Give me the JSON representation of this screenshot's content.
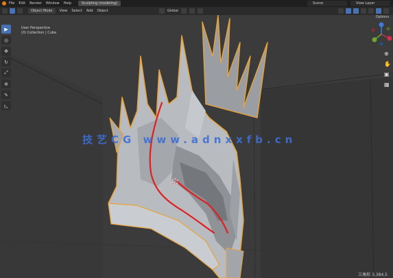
{
  "topbar": {
    "menu": [
      "File",
      "Edit",
      "Render",
      "Window",
      "Help"
    ],
    "workspace_tab": "Sculpting (modeling)",
    "scene_field": "Scene",
    "view_layer_field": "View Layer"
  },
  "header": {
    "mode": "Object Mode",
    "menus": [
      "View",
      "Select",
      "Add",
      "Object"
    ],
    "transform": "Global",
    "options_label": "Options"
  },
  "viewport": {
    "view_name": "User Perspective",
    "collection": "(0) Collection | Cube",
    "watermark": "技艺CG www.adnxxfb.cn",
    "bottom_text": "三角形 3,384,5"
  },
  "tools": [
    "select-box",
    "cursor",
    "move",
    "rotate",
    "scale",
    "transform",
    "annotate",
    "measure"
  ],
  "colors": {
    "selection_outline": "#e8a33a",
    "mesh": "#b8bbc0",
    "annotation": "#e02020",
    "accent": "#4772b3"
  }
}
